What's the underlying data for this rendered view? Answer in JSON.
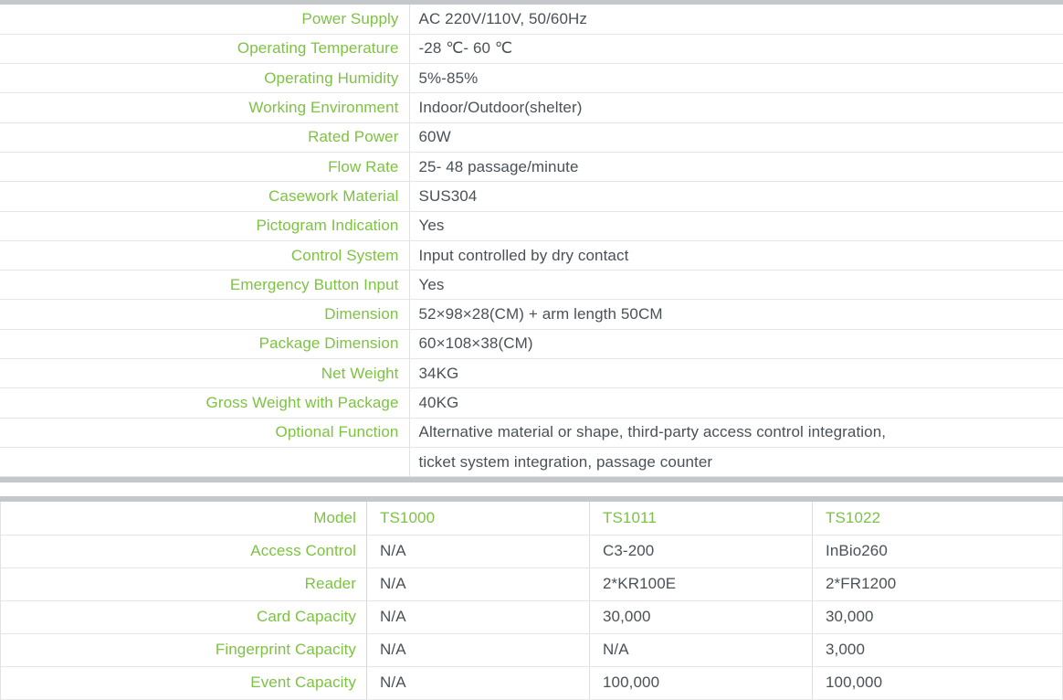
{
  "theme": {
    "label_green": "#7dc242",
    "value_gray": "#4a5157",
    "divider_gray": "#c4c8cb",
    "row_line": "#e4e6e8"
  },
  "spec_table": {
    "name": "product-specifications",
    "rows": [
      {
        "label": "Power Supply",
        "value": "AC 220V/110V, 50/60Hz"
      },
      {
        "label": "Operating Temperature",
        "value": "-28 ℃- 60 ℃"
      },
      {
        "label": "Operating Humidity",
        "value": "5%-85%"
      },
      {
        "label": "Working Environment",
        "value": "Indoor/Outdoor(shelter)"
      },
      {
        "label": "Rated Power",
        "value": "60W"
      },
      {
        "label": "Flow Rate",
        "value": "25- 48 passage/minute"
      },
      {
        "label": "Casework Material",
        "value": "SUS304"
      },
      {
        "label": "Pictogram Indication",
        "value": "Yes"
      },
      {
        "label": "Control System",
        "value": "Input controlled by dry contact"
      },
      {
        "label": "Emergency Button Input",
        "value": "Yes"
      },
      {
        "label": "Dimension",
        "value": "52×98×28(CM) + arm length 50CM"
      },
      {
        "label": "Package Dimension",
        "value": "60×108×38(CM)"
      },
      {
        "label": "Net Weight",
        "value": "34KG"
      },
      {
        "label": "Gross Weight with Package",
        "value": "40KG"
      },
      {
        "label": "Optional Function",
        "value": "Alternative material or shape, third-party access control integration,"
      },
      {
        "label": "",
        "value": "ticket system integration, passage counter"
      }
    ]
  },
  "model_table": {
    "name": "model-comparison",
    "header": {
      "label": "Model",
      "columns": [
        "TS1000",
        "TS1011",
        "TS1022"
      ]
    },
    "rows": [
      {
        "label": "Access Control",
        "values": [
          "N/A",
          "C3-200",
          "InBio260"
        ]
      },
      {
        "label": "Reader",
        "values": [
          "N/A",
          "2*KR100E",
          "2*FR1200"
        ]
      },
      {
        "label": "Card Capacity",
        "values": [
          "N/A",
          "30,000",
          "30,000"
        ]
      },
      {
        "label": "Fingerprint Capacity",
        "values": [
          "N/A",
          "N/A",
          "3,000"
        ]
      },
      {
        "label": "Event Capacity",
        "values": [
          "N/A",
          "100,000",
          "100,000"
        ]
      }
    ]
  }
}
